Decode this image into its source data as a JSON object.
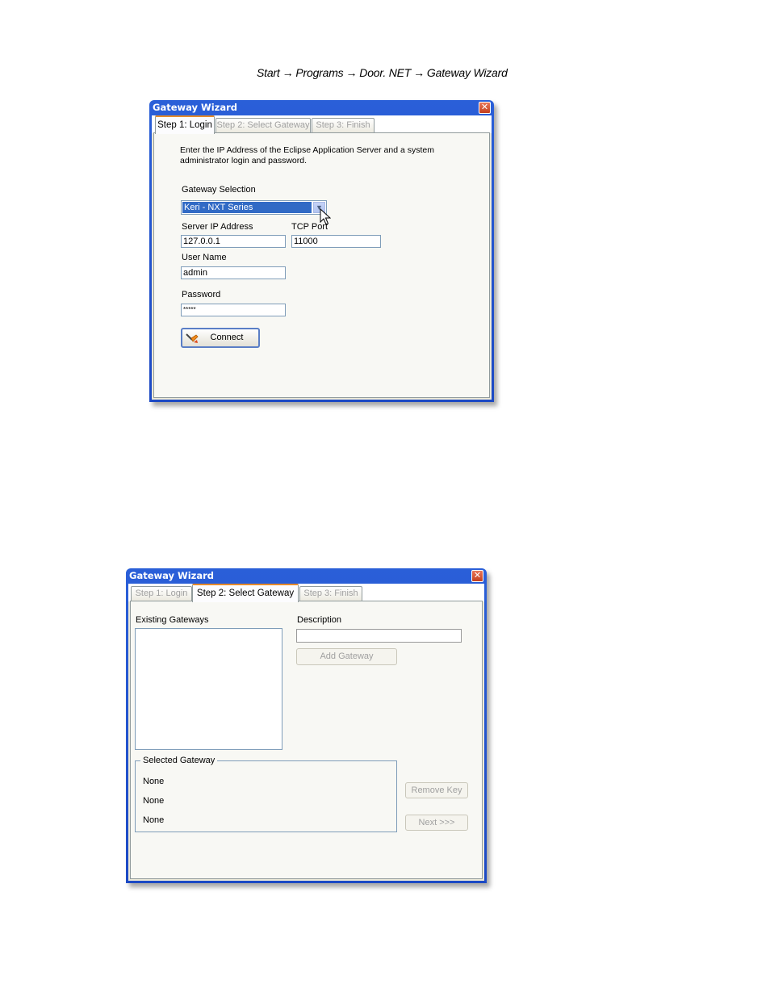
{
  "path": {
    "items": [
      "Start",
      "Programs",
      "Door. NET",
      "Gateway Wizard"
    ],
    "separator": "→"
  },
  "wizard1": {
    "title": "Gateway Wizard",
    "tabs": [
      "Step 1: Login",
      "Step 2: Select Gateway",
      "Step 3: Finish"
    ],
    "active_tab": 0,
    "intro": "Enter the IP Address of the Eclipse Application Server and a system administrator login and password.",
    "gateway_selection_label": "Gateway Selection",
    "gateway_selection_value": "Keri - NXT Series",
    "server_ip_label": "Server IP Address",
    "server_ip_value": "127.0.0.1",
    "tcp_port_label": "TCP Port",
    "tcp_port_value": "11000",
    "username_label": "User Name",
    "username_value": "admin",
    "password_label": "Password",
    "password_value": "*****",
    "connect_label": "Connect"
  },
  "wizard2": {
    "title": "Gateway Wizard",
    "tabs": [
      "Step 1: Login",
      "Step 2: Select Gateway",
      "Step 3: Finish"
    ],
    "active_tab": 1,
    "existing_gateways_label": "Existing Gateways",
    "description_label": "Description",
    "description_value": "",
    "add_gateway_label": "Add Gateway",
    "selected_gateway_label": "Selected Gateway",
    "selected_gateway_lines": [
      "None",
      "None",
      "None"
    ],
    "remove_key_label": "Remove Key",
    "next_label": "Next >>>"
  },
  "colors": {
    "titlebar": "#2a5fd8",
    "active_tab_accent": "#e68b2c",
    "dialog_bg": "#ece9d8"
  }
}
